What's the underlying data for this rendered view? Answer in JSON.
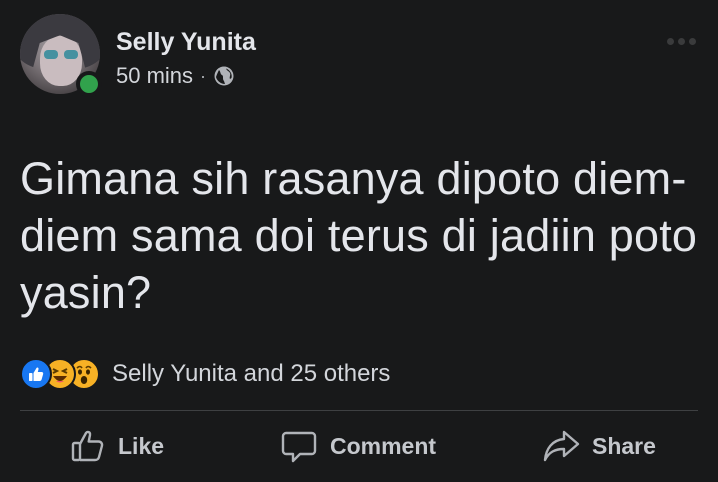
{
  "post": {
    "author": "Selly Yunita",
    "time": "50 mins",
    "separator": "·",
    "privacy_icon": "globe-icon",
    "text": "Gimana sih rasanya dipoto diem-diem sama doi terus di jadiin poto yasin?"
  },
  "reactions": {
    "icons": [
      "like-reaction-icon",
      "haha-reaction-icon",
      "wow-reaction-icon"
    ],
    "summary": "Selly Yunita and 25 others"
  },
  "actions": {
    "like_label": "Like",
    "comment_label": "Comment",
    "share_label": "Share"
  },
  "colors": {
    "background": "#18191a",
    "text": "#e4e6eb",
    "online": "#31a24c",
    "like_blue": "#1877f2",
    "emoji_yellow": "#f7b125"
  }
}
